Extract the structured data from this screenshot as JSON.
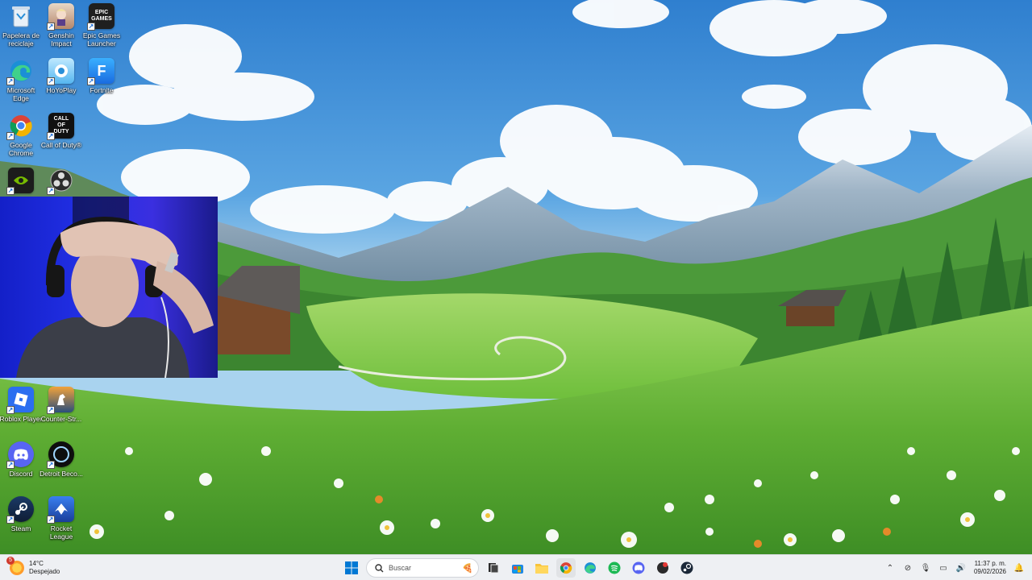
{
  "desktop": {
    "icons": [
      {
        "label": "Papelera de reciclaje",
        "icon": "recycle-bin-icon"
      },
      {
        "label": "Genshin Impact",
        "icon": "genshin-impact-icon"
      },
      {
        "label": "Epic Games Launcher",
        "icon": "epic-games-icon",
        "badge": "EPIC GAMES"
      },
      {
        "label": "Microsoft Edge",
        "icon": "edge-icon"
      },
      {
        "label": "HoYoPlay",
        "icon": "hoyoplay-icon"
      },
      {
        "label": "Fortnite",
        "icon": "fortnite-icon",
        "badge": "F"
      },
      {
        "label": "Google Chrome",
        "icon": "chrome-icon"
      },
      {
        "label": "Call of Duty®",
        "icon": "call-of-duty-icon",
        "badge": "CALL OF DUTY"
      },
      {
        "label": "",
        "icon": "nvidia-icon"
      },
      {
        "label": "",
        "icon": "obs-icon"
      },
      {
        "label": "Roblox Player",
        "icon": "roblox-icon"
      },
      {
        "label": "Counter-Str...",
        "icon": "counter-strike-icon"
      },
      {
        "label": "Discord",
        "icon": "discord-icon"
      },
      {
        "label": "Detroit Beco...",
        "icon": "detroit-icon"
      },
      {
        "label": "Steam",
        "icon": "steam-icon"
      },
      {
        "label": "Rocket League",
        "icon": "rocket-league-icon"
      }
    ]
  },
  "taskbar": {
    "weather": {
      "temp": "14°C",
      "condition": "Despejado",
      "badge": "5"
    },
    "search_placeholder": "Buscar",
    "pinned": [
      "file-explorer-icon",
      "task-view-icon",
      "store-icon",
      "folder-icon",
      "chrome-icon",
      "edge-icon",
      "spotify-icon",
      "discord-icon",
      "app-icon",
      "steam-icon"
    ],
    "clock": {
      "time": "11:37 p. m.",
      "date": "09/02/2026"
    }
  },
  "colors": {
    "taskbar_bg": "#eef0f3",
    "accent": "#0078d4"
  }
}
